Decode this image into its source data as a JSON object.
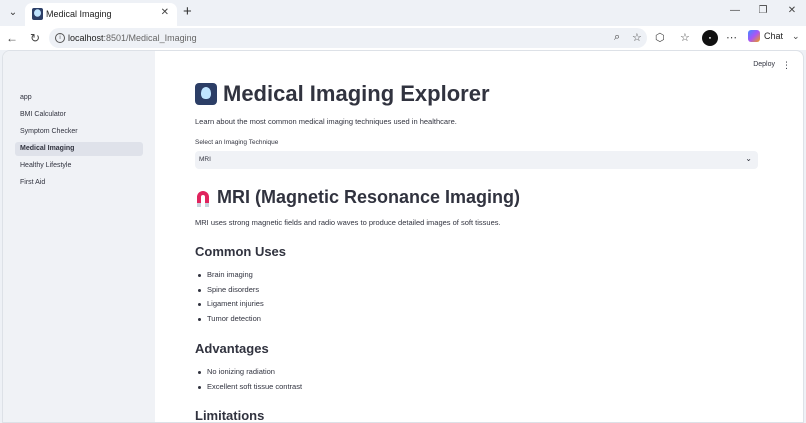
{
  "browser": {
    "tab_title": "Medical Imaging",
    "url_host": "localhost",
    "url_path": ":8501/Medical_Imaging",
    "chat_label": "Chat",
    "tab_icon": "medical-skull-icon"
  },
  "sidebar": {
    "items": [
      {
        "label": "app"
      },
      {
        "label": "BMI Calculator"
      },
      {
        "label": "Symptom Checker"
      },
      {
        "label": "Medical Imaging",
        "active": true
      },
      {
        "label": "Healthy Lifestyle"
      },
      {
        "label": "First Aid"
      }
    ]
  },
  "header": {
    "deploy_label": "Deploy"
  },
  "main": {
    "title": "Medical Imaging Explorer",
    "intro": "Learn about the most common medical imaging techniques used in healthcare.",
    "select_label": "Select an Imaging Technique",
    "select_value": "MRI",
    "section_title": "MRI (Magnetic Resonance Imaging)",
    "section_desc": "MRI uses strong magnetic fields and radio waves to produce detailed images of soft tissues.",
    "uses_heading": "Common Uses",
    "uses": [
      "Brain imaging",
      "Spine disorders",
      "Ligament injuries",
      "Tumor detection"
    ],
    "advantages_heading": "Advantages",
    "advantages": [
      "No ionizing radiation",
      "Excellent soft tissue contrast"
    ],
    "limitations_heading": "Limitations"
  },
  "colors": {
    "accent_magnet": "#e0245e",
    "sidebar_bg": "#f0f2f6",
    "text": "#31333f"
  }
}
